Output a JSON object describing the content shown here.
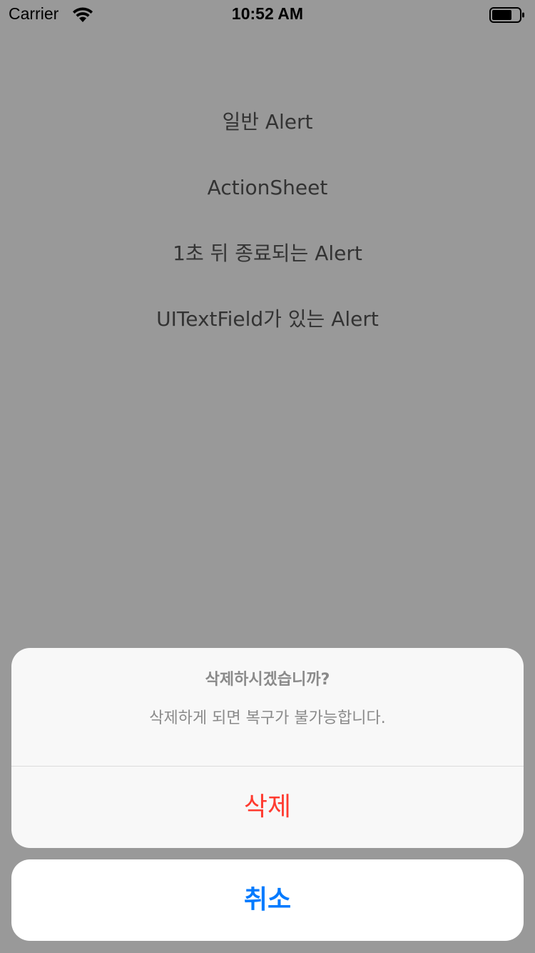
{
  "status_bar": {
    "carrier": "Carrier",
    "time": "10:52 AM",
    "wifi_icon": "wifi-icon",
    "battery_icon": "battery-icon"
  },
  "menu": {
    "items": [
      {
        "label": "일반 Alert"
      },
      {
        "label": "ActionSheet"
      },
      {
        "label": "1초 뒤 종료되는 Alert"
      },
      {
        "label": "UITextField가 있는 Alert"
      }
    ]
  },
  "action_sheet": {
    "title": "삭제하시겠습니까?",
    "message": "삭제하게 되면 복구가 불가능합니다.",
    "destructive_label": "삭제",
    "cancel_label": "취소"
  },
  "colors": {
    "overlay": "#000000",
    "tint": "#007aff",
    "destructive": "#ff3b30",
    "sheet_bg": "#f8f8f8"
  }
}
